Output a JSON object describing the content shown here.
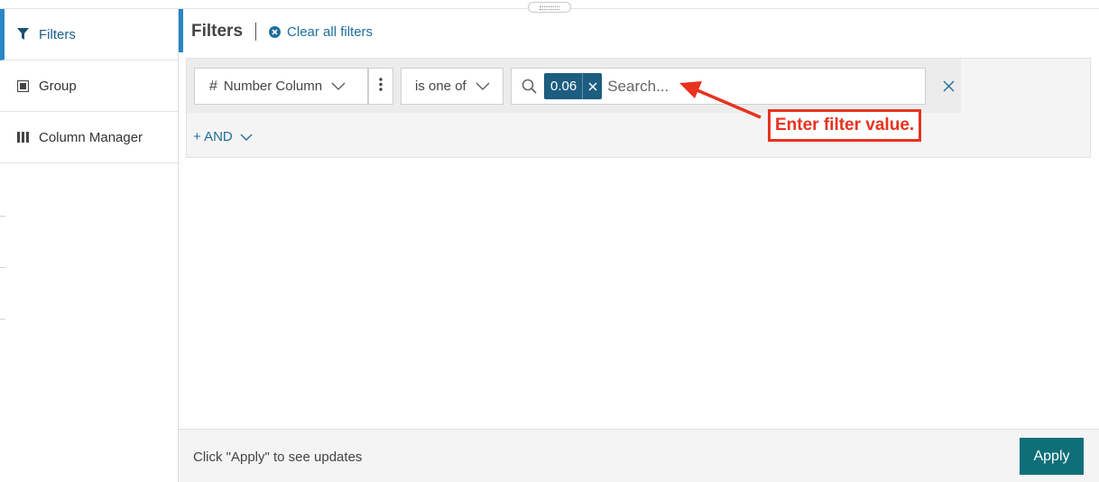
{
  "sidebar": {
    "items": [
      {
        "label": "Filters",
        "icon": "funnel-icon",
        "active": true
      },
      {
        "label": "Group",
        "icon": "group-icon",
        "active": false
      },
      {
        "label": "Column Manager",
        "icon": "columns-icon",
        "active": false
      }
    ]
  },
  "header": {
    "title": "Filters",
    "clear_all_label": "Clear all filters"
  },
  "filter_row": {
    "column": {
      "symbol": "#",
      "label": "Number Column"
    },
    "operator_label": "is one of",
    "chips": [
      "0.06"
    ],
    "search_placeholder": "Search..."
  },
  "and_button_label": "+ AND",
  "annotation": {
    "label": "Enter filter value.",
    "color": "#e8321e"
  },
  "footer": {
    "message": "Click \"Apply\" to see updates",
    "apply_label": "Apply"
  },
  "colors": {
    "accent": "#2a86c5",
    "link": "#1f6e9c",
    "chip": "#1d5d80",
    "apply": "#0f6f78"
  }
}
